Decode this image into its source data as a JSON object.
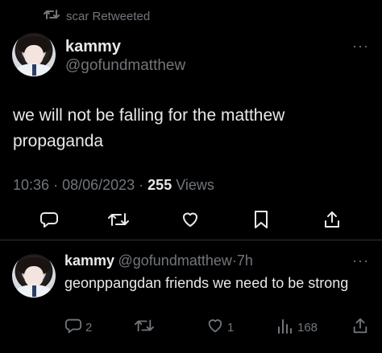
{
  "retweet_header": {
    "text": "scar Retweeted",
    "icon": "retweet-icon"
  },
  "main_tweet": {
    "display_name": "kammy",
    "handle": "@gofundmatthew",
    "text": "we will not be falling for the matthew propaganda",
    "time": "10:36",
    "date": "08/06/2023",
    "views_count": "255",
    "views_label": "Views",
    "more": "···"
  },
  "reply": {
    "display_name": "kammy",
    "handle": "@gofundmatthew",
    "age": "7h",
    "text": "geonppangdan friends we need to be strong",
    "more": "···",
    "replies": "2",
    "likes": "1",
    "views": "168"
  },
  "colors": {
    "background": "#000000",
    "text": "#e7e9ea",
    "muted": "#71767b",
    "divider": "#2f3336"
  }
}
